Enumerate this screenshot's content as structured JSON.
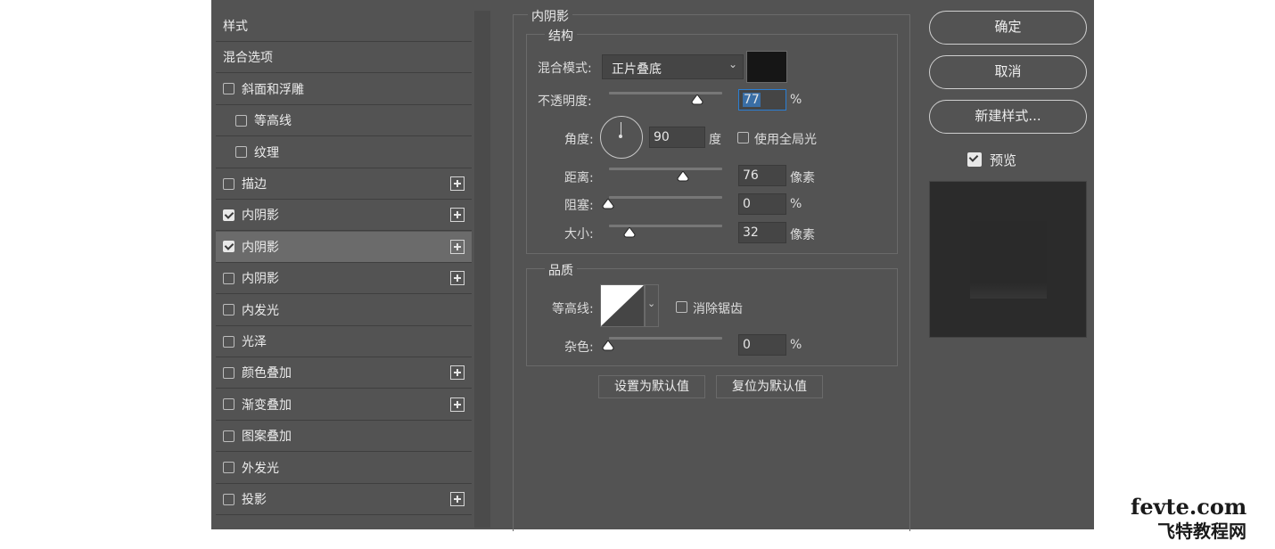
{
  "style_list": {
    "items": [
      {
        "label": "样式",
        "checkbox": false,
        "checked": false,
        "plus": false,
        "indent": false,
        "selected": false
      },
      {
        "label": "混合选项",
        "checkbox": false,
        "checked": false,
        "plus": false,
        "indent": false,
        "selected": false
      },
      {
        "label": "斜面和浮雕",
        "checkbox": true,
        "checked": false,
        "plus": false,
        "indent": false,
        "selected": false
      },
      {
        "label": "等高线",
        "checkbox": true,
        "checked": false,
        "plus": false,
        "indent": true,
        "selected": false
      },
      {
        "label": "纹理",
        "checkbox": true,
        "checked": false,
        "plus": false,
        "indent": true,
        "selected": false
      },
      {
        "label": "描边",
        "checkbox": true,
        "checked": false,
        "plus": true,
        "indent": false,
        "selected": false
      },
      {
        "label": "内阴影",
        "checkbox": true,
        "checked": true,
        "plus": true,
        "indent": false,
        "selected": false
      },
      {
        "label": "内阴影",
        "checkbox": true,
        "checked": true,
        "plus": true,
        "indent": false,
        "selected": true
      },
      {
        "label": "内阴影",
        "checkbox": true,
        "checked": false,
        "plus": true,
        "indent": false,
        "selected": false
      },
      {
        "label": "内发光",
        "checkbox": true,
        "checked": false,
        "plus": false,
        "indent": false,
        "selected": false
      },
      {
        "label": "光泽",
        "checkbox": true,
        "checked": false,
        "plus": false,
        "indent": false,
        "selected": false
      },
      {
        "label": "颜色叠加",
        "checkbox": true,
        "checked": false,
        "plus": true,
        "indent": false,
        "selected": false
      },
      {
        "label": "渐变叠加",
        "checkbox": true,
        "checked": false,
        "plus": true,
        "indent": false,
        "selected": false
      },
      {
        "label": "图案叠加",
        "checkbox": true,
        "checked": false,
        "plus": false,
        "indent": false,
        "selected": false
      },
      {
        "label": "外发光",
        "checkbox": true,
        "checked": false,
        "plus": false,
        "indent": false,
        "selected": false
      },
      {
        "label": "投影",
        "checkbox": true,
        "checked": false,
        "plus": true,
        "indent": false,
        "selected": false
      }
    ]
  },
  "inner_shadow": {
    "title": "内阴影",
    "structure": {
      "legend": "结构",
      "blend_mode_label": "混合模式:",
      "blend_mode_value": "正片叠底",
      "color": "#161616",
      "opacity_label": "不透明度:",
      "opacity_value": "77",
      "opacity_unit": "%",
      "angle_label": "角度:",
      "angle_value": "90",
      "angle_unit": "度",
      "global_light_label": "使用全局光",
      "global_light_checked": false,
      "distance_label": "距离:",
      "distance_value": "76",
      "distance_unit": "像素",
      "choke_label": "阻塞:",
      "choke_value": "0",
      "choke_unit": "%",
      "size_label": "大小:",
      "size_value": "32",
      "size_unit": "像素"
    },
    "quality": {
      "legend": "品质",
      "contour_label": "等高线:",
      "antialias_label": "消除锯齿",
      "antialias_checked": false,
      "noise_label": "杂色:",
      "noise_value": "0",
      "noise_unit": "%"
    },
    "set_default_label": "设置为默认值",
    "reset_default_label": "复位为默认值"
  },
  "right_panel": {
    "ok_label": "确定",
    "cancel_label": "取消",
    "new_style_label": "新建样式...",
    "preview_label": "预览",
    "preview_checked": true
  },
  "watermark": {
    "line1": "fevte.com",
    "line2": "飞特教程网"
  }
}
